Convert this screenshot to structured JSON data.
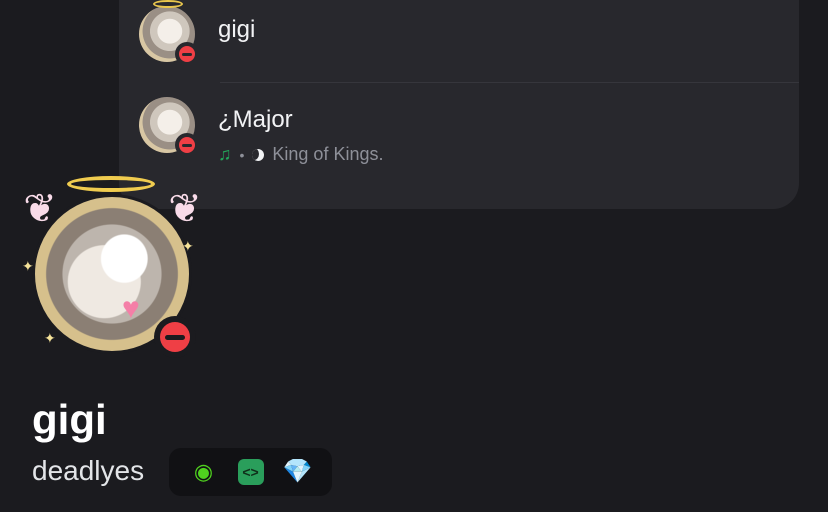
{
  "friends": [
    {
      "name": "gigi",
      "status": "dnd"
    },
    {
      "name": "¿Major",
      "status": "dnd",
      "activity": {
        "music_icon": "music-note-icon",
        "separator": "•",
        "custom_status": "King of Kings."
      }
    }
  ],
  "profile": {
    "display_name": "gigi",
    "username": "deadlyes",
    "status": "dnd",
    "badges": [
      {
        "name": "boost-badge-icon",
        "glyph": "◉"
      },
      {
        "name": "active-developer-badge-icon",
        "glyph": "<>"
      },
      {
        "name": "nitro-gem-badge-icon",
        "glyph": "💎"
      }
    ]
  },
  "colors": {
    "background": "#1b1b1f",
    "card": "#28282d",
    "dnd": "#ef3f45",
    "music_green": "#23a55a",
    "muted_text": "#8e9099"
  }
}
